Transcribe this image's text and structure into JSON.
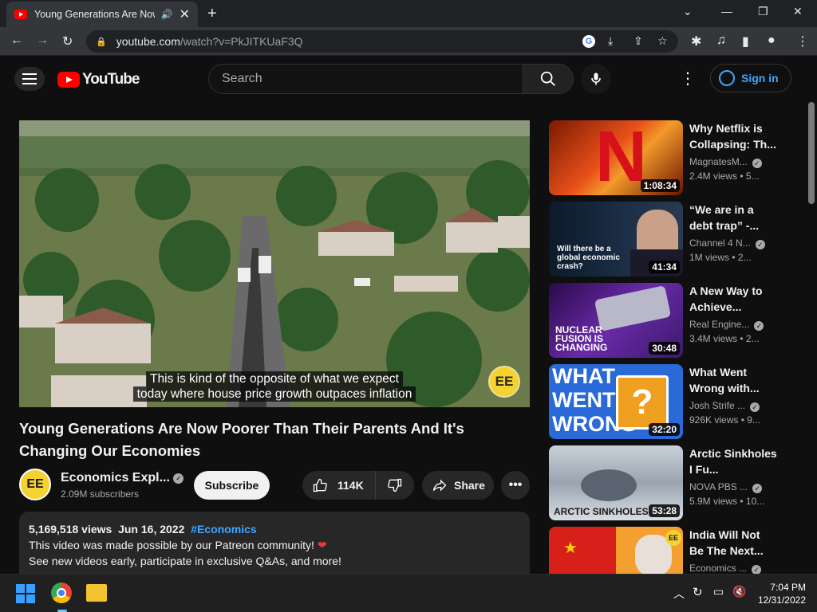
{
  "browser": {
    "tab_title": "Young Generations Are Now Poorer Than Their Parents",
    "tab_audio_icon": "speaker-icon",
    "url_host": "youtube.com",
    "url_path": "/watch?v=PkJITKUaF3Q"
  },
  "header": {
    "logo_text": "YouTube",
    "search_placeholder": "Search",
    "signin_label": "Sign in"
  },
  "video": {
    "caption_line1": "This is kind of the opposite of what we expect",
    "caption_line2": "today where house price growth outpaces inflation",
    "watermark": "EE",
    "title": "Young Generations Are Now Poorer Than Their Parents And It's Changing Our Economies",
    "channel_avatar": "EE",
    "channel_name": "Economics Expl...",
    "subscribers": "2.09M subscribers",
    "subscribe_label": "Subscribe",
    "likes": "114K",
    "share_label": "Share",
    "views": "5,169,518 views",
    "date": "Jun 16, 2022",
    "hashtag": "#Economics",
    "desc_line1": "This video was made possible by our Patreon community!",
    "desc_line2": "See new videos early, participate in exclusive Q&As, and more!"
  },
  "sidebar": {
    "items": [
      {
        "title": "Why Netflix is Collapsing: Th...",
        "channel": "MagnatesM...",
        "views": "2.4M views",
        "age": "5...",
        "duration": "1:08:34",
        "thumb_text": "N"
      },
      {
        "title": "“We are in a debt trap” -...",
        "channel": "Channel 4 N...",
        "views": "1M views",
        "age": "2...",
        "duration": "41:34",
        "thumb_text": "Will there be a global economic crash?"
      },
      {
        "title": "A New Way to Achieve...",
        "channel": "Real Engine...",
        "views": "3.4M views",
        "age": "2...",
        "duration": "30:48",
        "thumb_text": "NUCLEAR FUSION IS CHANGING"
      },
      {
        "title": "What Went Wrong with...",
        "channel": "Josh Strife ...",
        "views": "926K views",
        "age": "9...",
        "duration": "32:20",
        "thumb_text": "WHAT WENT WRONG"
      },
      {
        "title": "Arctic Sinkholes I Fu...",
        "channel": "NOVA PBS ...",
        "views": "5.9M views",
        "age": "10...",
        "duration": "53:28",
        "thumb_text": "ARCTIC SINKHOLES"
      },
      {
        "title": "India Will Not Be The Next...",
        "channel": "Economics ...",
        "views": "",
        "age": "",
        "duration": "",
        "thumb_text": "EE"
      }
    ]
  },
  "taskbar": {
    "time": "7:04 PM",
    "date": "12/31/2022"
  }
}
